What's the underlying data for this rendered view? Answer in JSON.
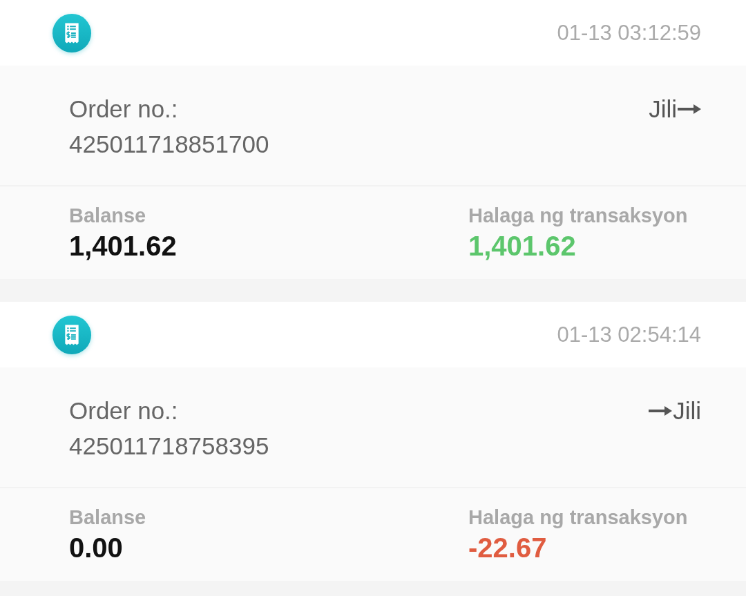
{
  "transactions": [
    {
      "time": "01-13 03:12:59",
      "order_label": "Order no.:",
      "order_no": "425011718851700",
      "transfer": {
        "kind": "from",
        "label": "Jili"
      },
      "balance": {
        "label": "Balanse",
        "value": "1,401.62"
      },
      "amount": {
        "label": "Halaga ng transaksyon",
        "value": "1,401.62",
        "color": "#5cc66c"
      }
    },
    {
      "time": "01-13 02:54:14",
      "order_label": "Order no.:",
      "order_no": "425011718758395",
      "transfer": {
        "kind": "to",
        "label": "Jili"
      },
      "balance": {
        "label": "Balanse",
        "value": "0.00"
      },
      "amount": {
        "label": "Halaga ng transaksyon",
        "value": "-22.67",
        "color": "#e05c40"
      }
    }
  ]
}
